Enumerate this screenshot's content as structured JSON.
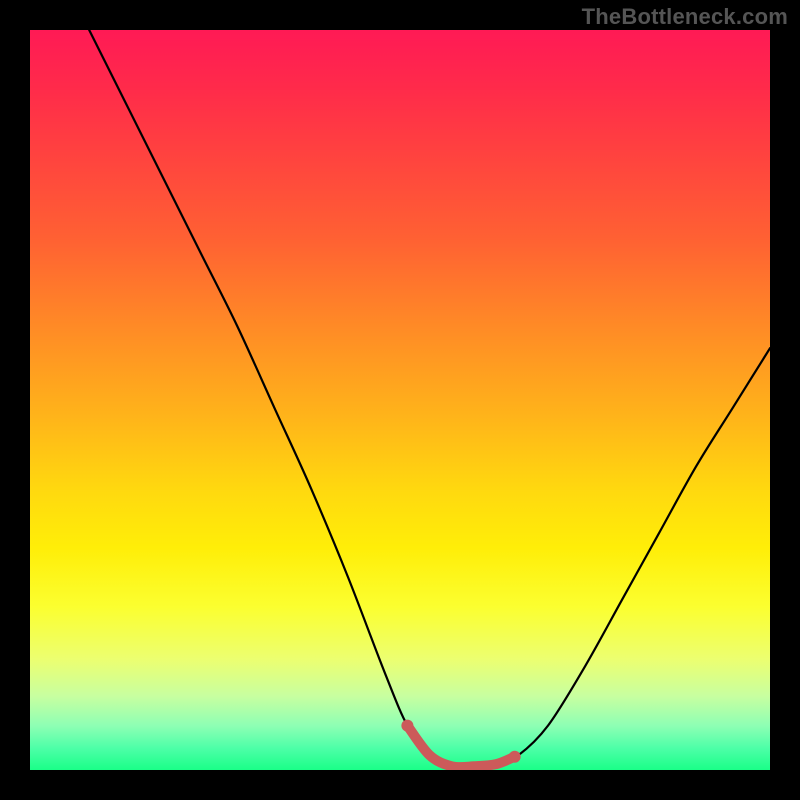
{
  "watermark": "TheBottleneck.com",
  "colors": {
    "page_bg": "#000000",
    "watermark": "#555555",
    "curve": "#000000",
    "highlight": "#cc5a5a",
    "gradient_stops": [
      "#ff1a55",
      "#ff2b4a",
      "#ff4040",
      "#ff6033",
      "#ff8a26",
      "#ffb31a",
      "#ffd80f",
      "#ffee08",
      "#fbff30",
      "#ecff70",
      "#c8ffa0",
      "#8effb4",
      "#4effa8",
      "#1aff88"
    ]
  },
  "chart_data": {
    "type": "line",
    "title": "",
    "xlabel": "",
    "ylabel": "",
    "xlim": [
      0,
      100
    ],
    "ylim": [
      0,
      100
    ],
    "x": [
      3,
      8,
      13,
      18,
      23,
      28,
      33,
      38,
      43,
      48,
      51,
      54,
      57,
      60,
      63,
      66,
      70,
      75,
      80,
      85,
      90,
      95,
      100
    ],
    "values": [
      110,
      100,
      90,
      80,
      70,
      60,
      49,
      38,
      26,
      13,
      6,
      2,
      0.5,
      0.5,
      0.8,
      2,
      6,
      14,
      23,
      32,
      41,
      49,
      57
    ],
    "highlight_x_range": [
      51,
      65.5
    ],
    "note": "V-shaped bottleneck curve; highlighted flat minimum segment near bottom."
  }
}
